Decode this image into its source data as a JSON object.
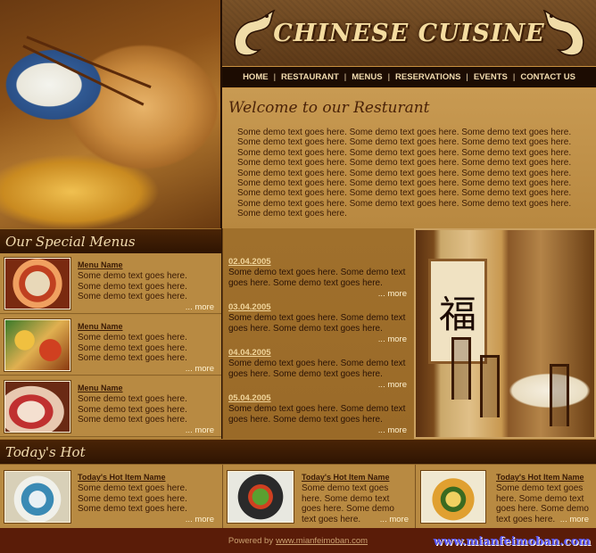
{
  "brand": {
    "title": "CHINESE CUISINE"
  },
  "nav": {
    "items": [
      "HOME",
      "RESTAURANT",
      "MENUS",
      "RESERVATIONS",
      "EVENTS",
      "CONTACT US"
    ],
    "separator": "|"
  },
  "welcome": {
    "title": "Welcome to our Resturant",
    "body": "Some demo text goes here. Some demo text goes here. Some demo text goes here. Some demo text goes here. Some demo text goes here. Some demo text goes here. Some demo text goes here. Some demo text goes here. Some demo text goes here. Some demo text goes here. Some demo text goes here. Some demo text goes here. Some demo text goes here. Some demo text goes here. Some demo text goes here. Some demo text goes here. Some demo text goes here. Some demo text goes here. Some demo text goes here. Some demo text goes here. Some demo text goes here. Some demo text goes here. Some demo text goes here. Some demo text goes here. Some demo text goes here."
  },
  "special_menus": {
    "heading": "Our Special Menus",
    "items": [
      {
        "title": "Menu Name",
        "text": "Some demo text goes here. Some demo text goes here. Some demo text goes here.",
        "more": "... more"
      },
      {
        "title": "Menu Name",
        "text": "Some demo text goes here. Some demo text goes here. Some demo text goes here.",
        "more": "... more"
      },
      {
        "title": "Menu Name",
        "text": "Some demo text goes here. Some demo text goes here. Some demo text goes here.",
        "more": "... more"
      }
    ]
  },
  "news": {
    "items": [
      {
        "date": "02.04.2005",
        "text": "Some demo text goes here. Some demo text goes here. Some demo text goes here.",
        "more": "... more"
      },
      {
        "date": "03.04.2005",
        "text": "Some demo text goes here. Some demo text goes here. Some demo text goes here.",
        "more": "... more"
      },
      {
        "date": "04.04.2005",
        "text": "Some demo text goes here. Some demo text goes here. Some demo text goes here.",
        "more": "... more"
      },
      {
        "date": "05.04.2005",
        "text": "Some demo text goes here. Some demo text goes here. Some demo text goes here.",
        "more": "... more"
      }
    ]
  },
  "todays_hot": {
    "heading": "Today's Hot",
    "items": [
      {
        "title": "Today's Hot Item Name",
        "text": "Some demo text goes here. Some demo text goes here. Some demo text goes here.",
        "more": "... more"
      },
      {
        "title": "Today's Hot Item Name",
        "text": "Some demo text goes here. Some demo text goes here. Some demo text goes here.",
        "more": "... more"
      },
      {
        "title": "Today's Hot Item Name",
        "text": "Some demo text goes here. Some demo text goes here. Some demo text goes here.",
        "more": "... more"
      }
    ]
  },
  "footer": {
    "powered_by": "Powered by",
    "link": "www.mianfeimoban.com"
  },
  "watermark": "www.mianfeimoban.com",
  "dining_photo": {
    "calligraphy": "福"
  },
  "colors": {
    "accent": "#f4dca0",
    "panel": "#b88a42",
    "dark": "#2e1402",
    "footer": "#5a1c08"
  }
}
